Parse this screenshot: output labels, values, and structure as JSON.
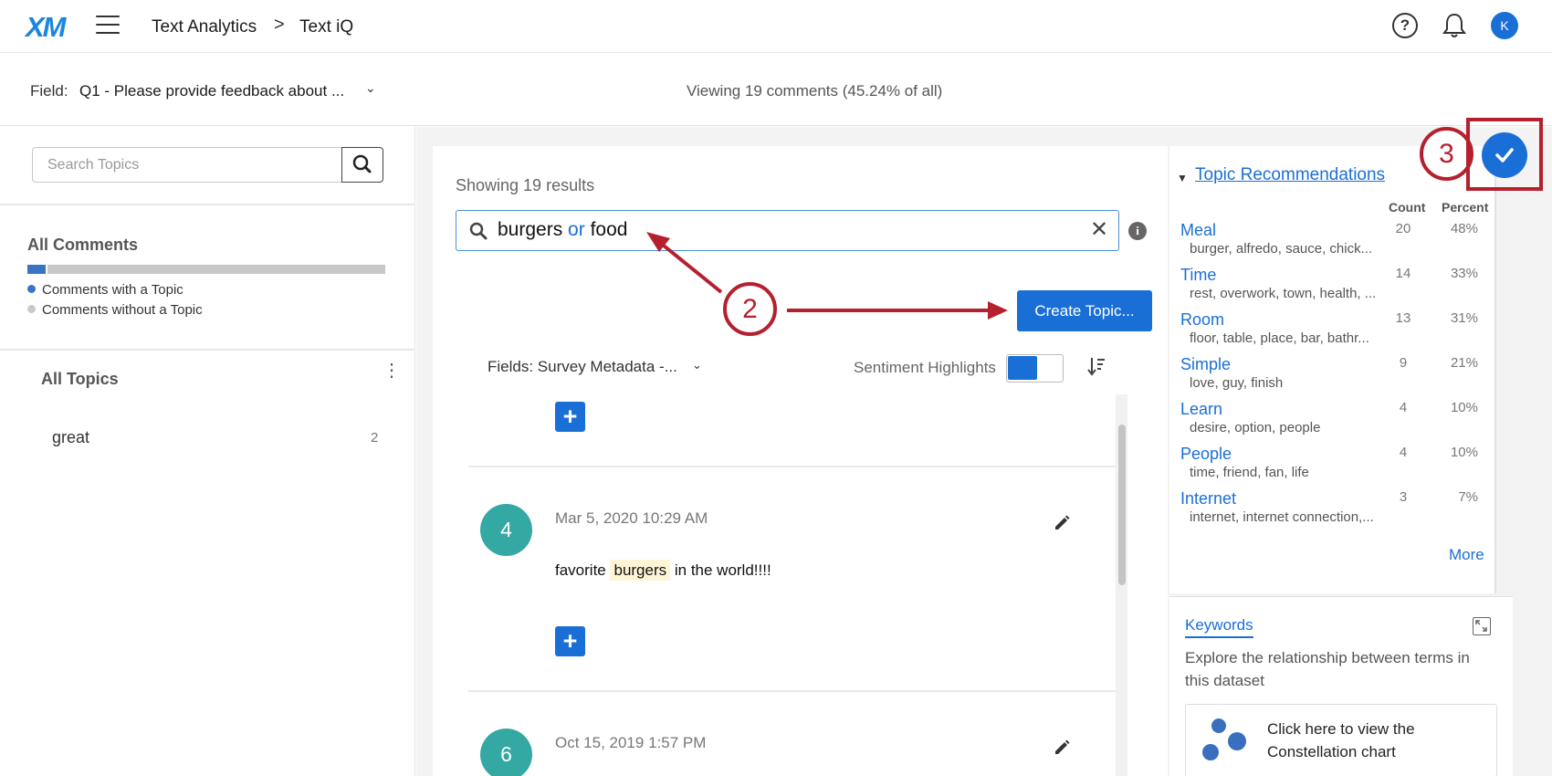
{
  "header": {
    "logo": "XM",
    "breadcrumb_1": "Text Analytics",
    "breadcrumb_sep": ">",
    "breadcrumb_2": "Text iQ",
    "help_glyph": "?",
    "avatar_initial": "K"
  },
  "fieldbar": {
    "label": "Field:",
    "value": "Q1 - Please provide feedback about ...",
    "viewing": "Viewing 19 comments (45.24% of all)"
  },
  "sidebar": {
    "search_placeholder": "Search Topics",
    "all_comments": "All Comments",
    "with_topic": "Comments with a Topic",
    "without_topic": "Comments without a Topic",
    "all_topics": "All Topics",
    "topics": [
      {
        "label": "great",
        "count": "2"
      }
    ]
  },
  "center": {
    "showing": "Showing 19 results",
    "query_term1": "burgers",
    "query_op": "or",
    "query_term2": "food",
    "info_glyph": "i",
    "create_topic": "Create Topic...",
    "fields_dropdown": "Fields: Survey Metadata -...",
    "sentiment_highlights": "Sentiment Highlights",
    "comments": [
      {
        "number": "4",
        "date": "Mar 5, 2020 10:29 AM",
        "text_before": "favorite",
        "highlight": "burgers",
        "text_after": "in the world!!!!"
      },
      {
        "number": "6",
        "date": "Oct 15, 2019 1:57 PM"
      }
    ]
  },
  "recommendations": {
    "title": "Topic Recommendations",
    "count_header": "Count",
    "percent_header": "Percent",
    "items": [
      {
        "name": "Meal",
        "keywords": "burger, alfredo, sauce, chick...",
        "count": "20",
        "percent": "48%"
      },
      {
        "name": "Time",
        "keywords": "rest, overwork, town, health, ...",
        "count": "14",
        "percent": "33%"
      },
      {
        "name": "Room",
        "keywords": "floor, table, place, bar, bathr...",
        "count": "13",
        "percent": "31%"
      },
      {
        "name": "Simple",
        "keywords": "love, guy, finish",
        "count": "9",
        "percent": "21%"
      },
      {
        "name": "Learn",
        "keywords": "desire, option, people",
        "count": "4",
        "percent": "10%"
      },
      {
        "name": "People",
        "keywords": "time, friend, fan, life",
        "count": "4",
        "percent": "10%"
      },
      {
        "name": "Internet",
        "keywords": "internet, internet connection,...",
        "count": "3",
        "percent": "7%"
      }
    ],
    "more": "More"
  },
  "keywords": {
    "title": "Keywords",
    "description": "Explore the relationship between terms in this dataset",
    "constellation": "Click here to view the Constellation chart"
  },
  "annotations": {
    "step2": "2",
    "step3": "3"
  },
  "colors": {
    "accent": "#1a6fd6",
    "annotation": "#b5202e",
    "comment_circle": "#34a9a3",
    "highlight": "#fff5d6"
  },
  "topic_coverage_fraction": 0.05
}
